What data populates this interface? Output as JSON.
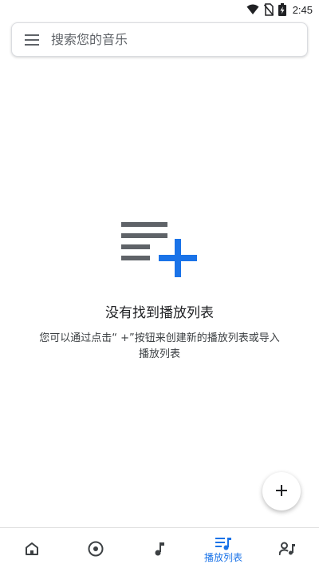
{
  "status_bar": {
    "time": "2:45",
    "icons": [
      "wifi-icon",
      "no-sim-icon",
      "battery-charging-icon"
    ]
  },
  "search": {
    "placeholder": "搜索您的音乐",
    "menu_icon": "hamburger-menu-icon"
  },
  "empty_state": {
    "icon": "playlist-add-icon",
    "title": "没有找到播放列表",
    "description": "您可以通过点击“ +”按钮来创建新的播放列表或导入播放列表"
  },
  "fab": {
    "icon": "plus-icon"
  },
  "bottom_nav": {
    "items": [
      {
        "icon": "home-icon",
        "label": ""
      },
      {
        "icon": "album-icon",
        "label": ""
      },
      {
        "icon": "music-note-icon",
        "label": ""
      },
      {
        "icon": "playlist-icon",
        "label": "播放列表",
        "active": true
      },
      {
        "icon": "artist-icon",
        "label": ""
      }
    ]
  },
  "colors": {
    "accent": "#1a73e8",
    "icon_gray": "#5f6368",
    "text": "#202124"
  }
}
